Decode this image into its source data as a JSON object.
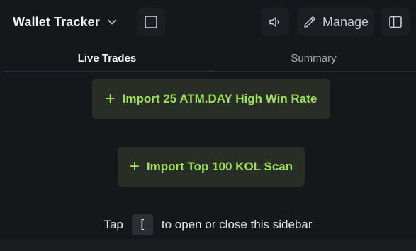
{
  "header": {
    "title": "Wallet Tracker",
    "manage_label": "Manage"
  },
  "tabs": [
    {
      "label": "Live Trades",
      "active": true
    },
    {
      "label": "Summary",
      "active": false
    }
  ],
  "actions": {
    "import_atm": "Import 25 ATM.DAY High Win Rate",
    "import_kol": "Import Top 100 KOL Scan",
    "plus_symbol": "+"
  },
  "hint": {
    "prefix": "Tap",
    "key": "[",
    "suffix": "to open or close this sidebar"
  },
  "colors": {
    "accent_green": "#9ee05d",
    "button_bg": "#282e25",
    "panel_bg": "#16171b"
  },
  "icons": [
    "chevron-down-icon",
    "square-icon",
    "speaker-icon",
    "pencil-icon",
    "sidebar-toggle-icon",
    "plus-icon"
  ]
}
